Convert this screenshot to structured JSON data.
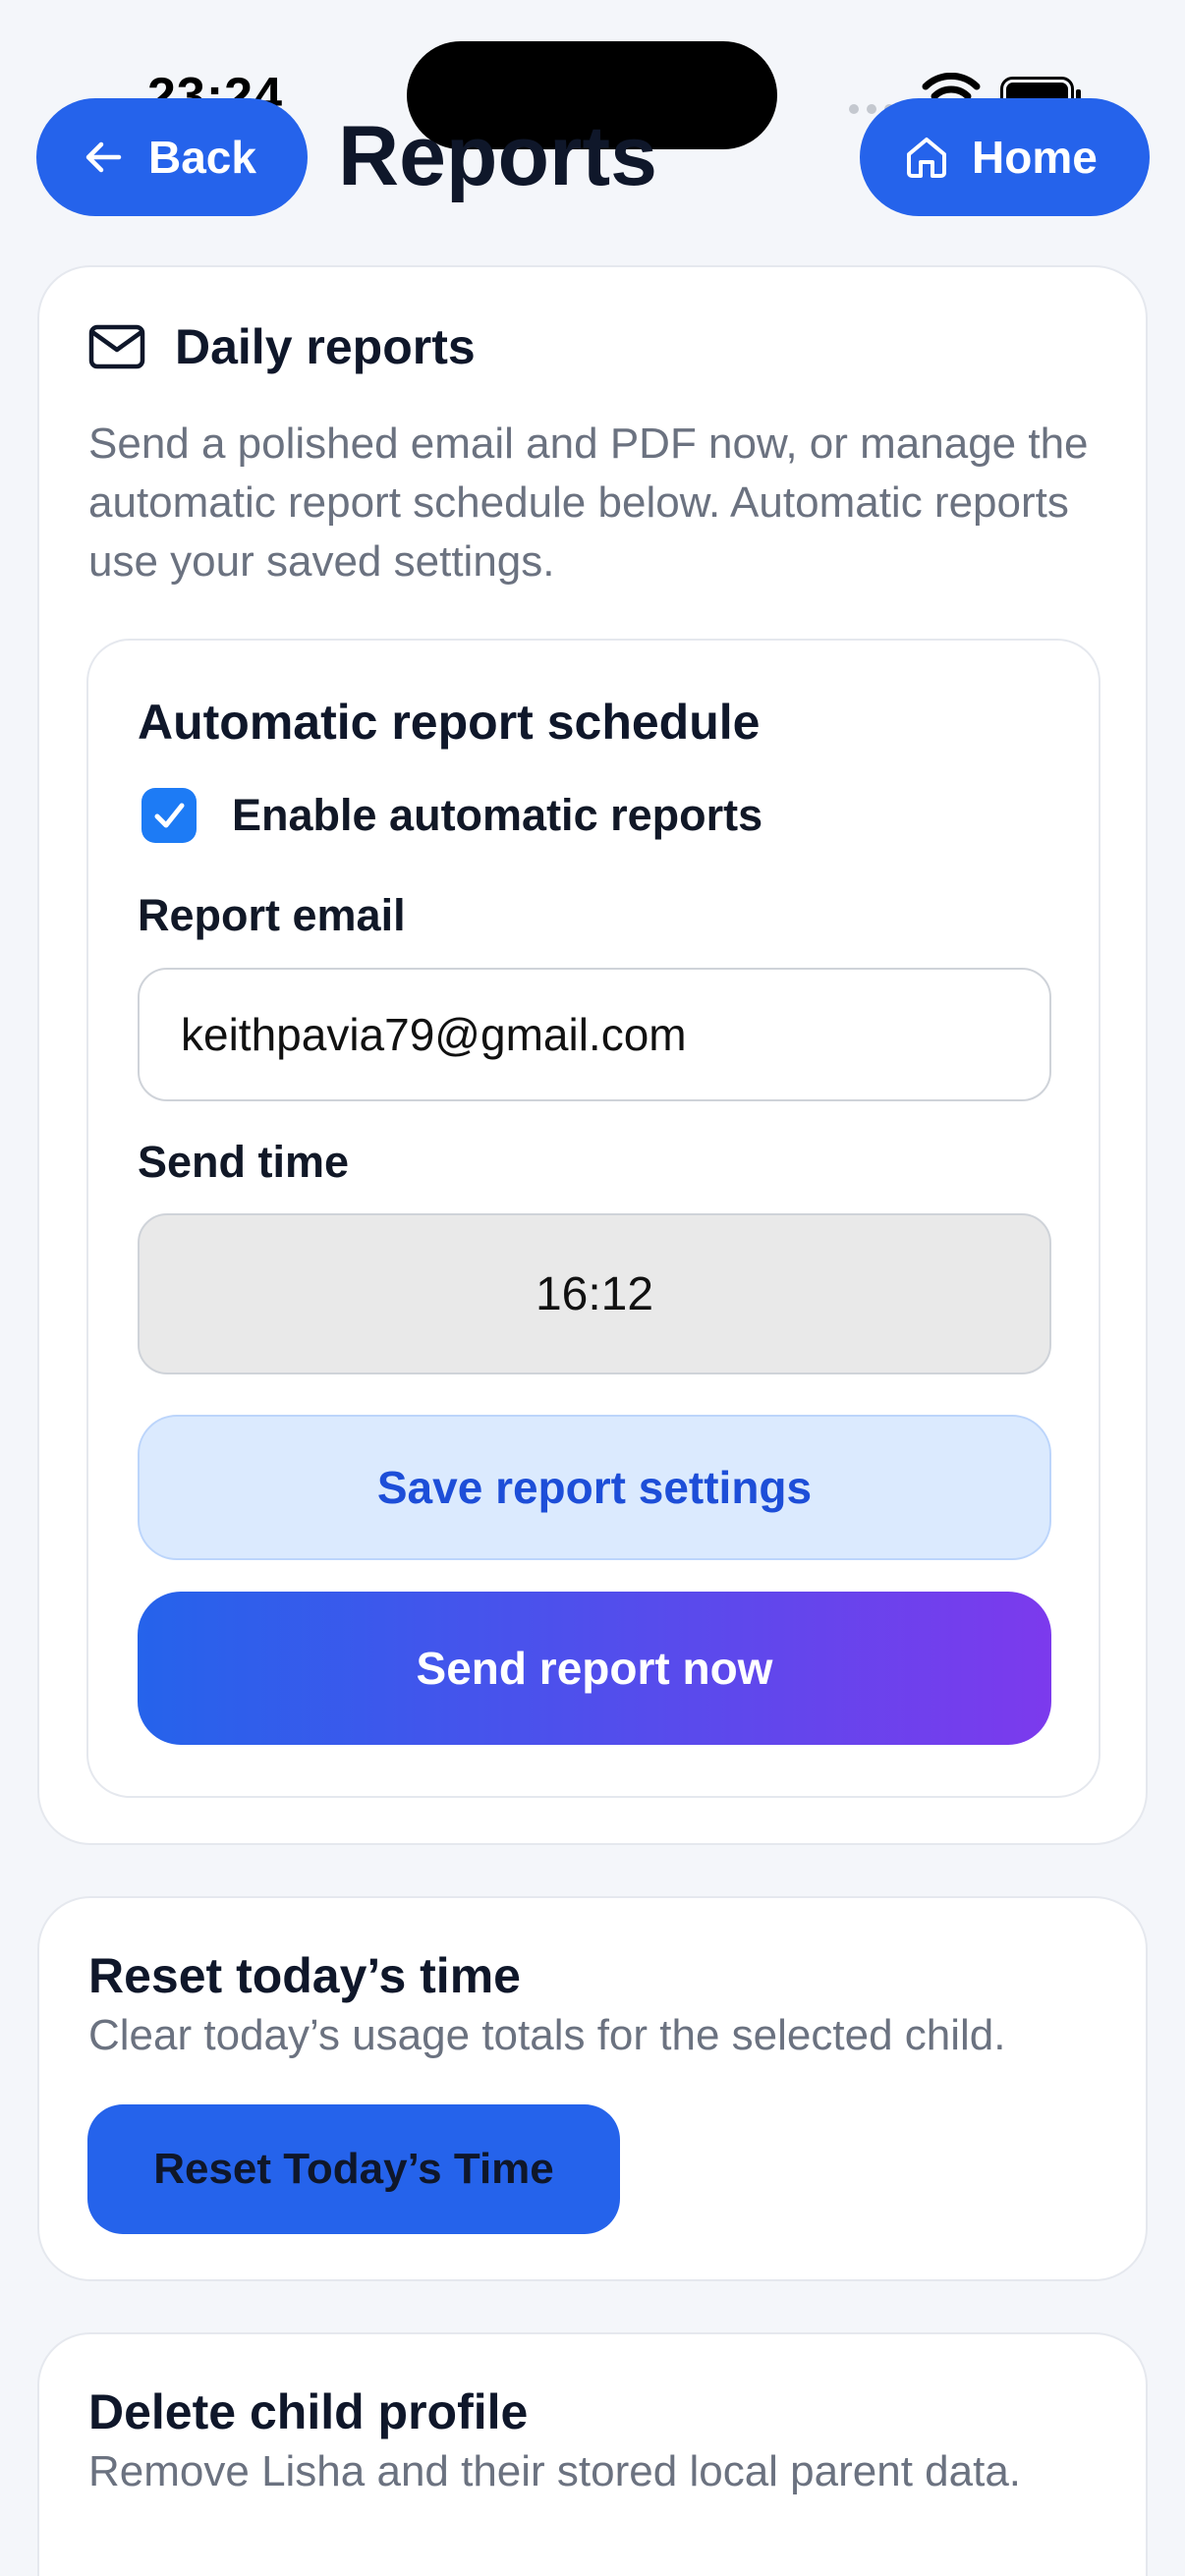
{
  "status_bar": {
    "time": "23:24"
  },
  "header": {
    "back_label": "Back",
    "title": "Reports",
    "home_label": "Home"
  },
  "daily_reports": {
    "title": "Daily reports",
    "description": "Send a polished email and PDF now, or manage the automatic report schedule below. Automatic reports use your saved settings.",
    "schedule": {
      "title": "Automatic report schedule",
      "enable_label": "Enable automatic reports",
      "enabled": true,
      "email_label": "Report email",
      "email_value": "keithpavia79@gmail.com",
      "time_label": "Send time",
      "time_value": "16:12",
      "save_label": "Save report settings",
      "send_label": "Send report now"
    }
  },
  "reset": {
    "title": "Reset today’s time",
    "description": "Clear today’s usage totals for the selected child.",
    "button_label": "Reset Today’s Time"
  },
  "delete": {
    "title": "Delete child profile",
    "description": "Remove Lisha and their stored local parent data."
  },
  "colors": {
    "primary": "#2563eb",
    "gradient_end": "#7c3aed",
    "save_bg": "#dbeafe",
    "checkbox": "#1d7bf5",
    "background": "#f4f6fa"
  }
}
